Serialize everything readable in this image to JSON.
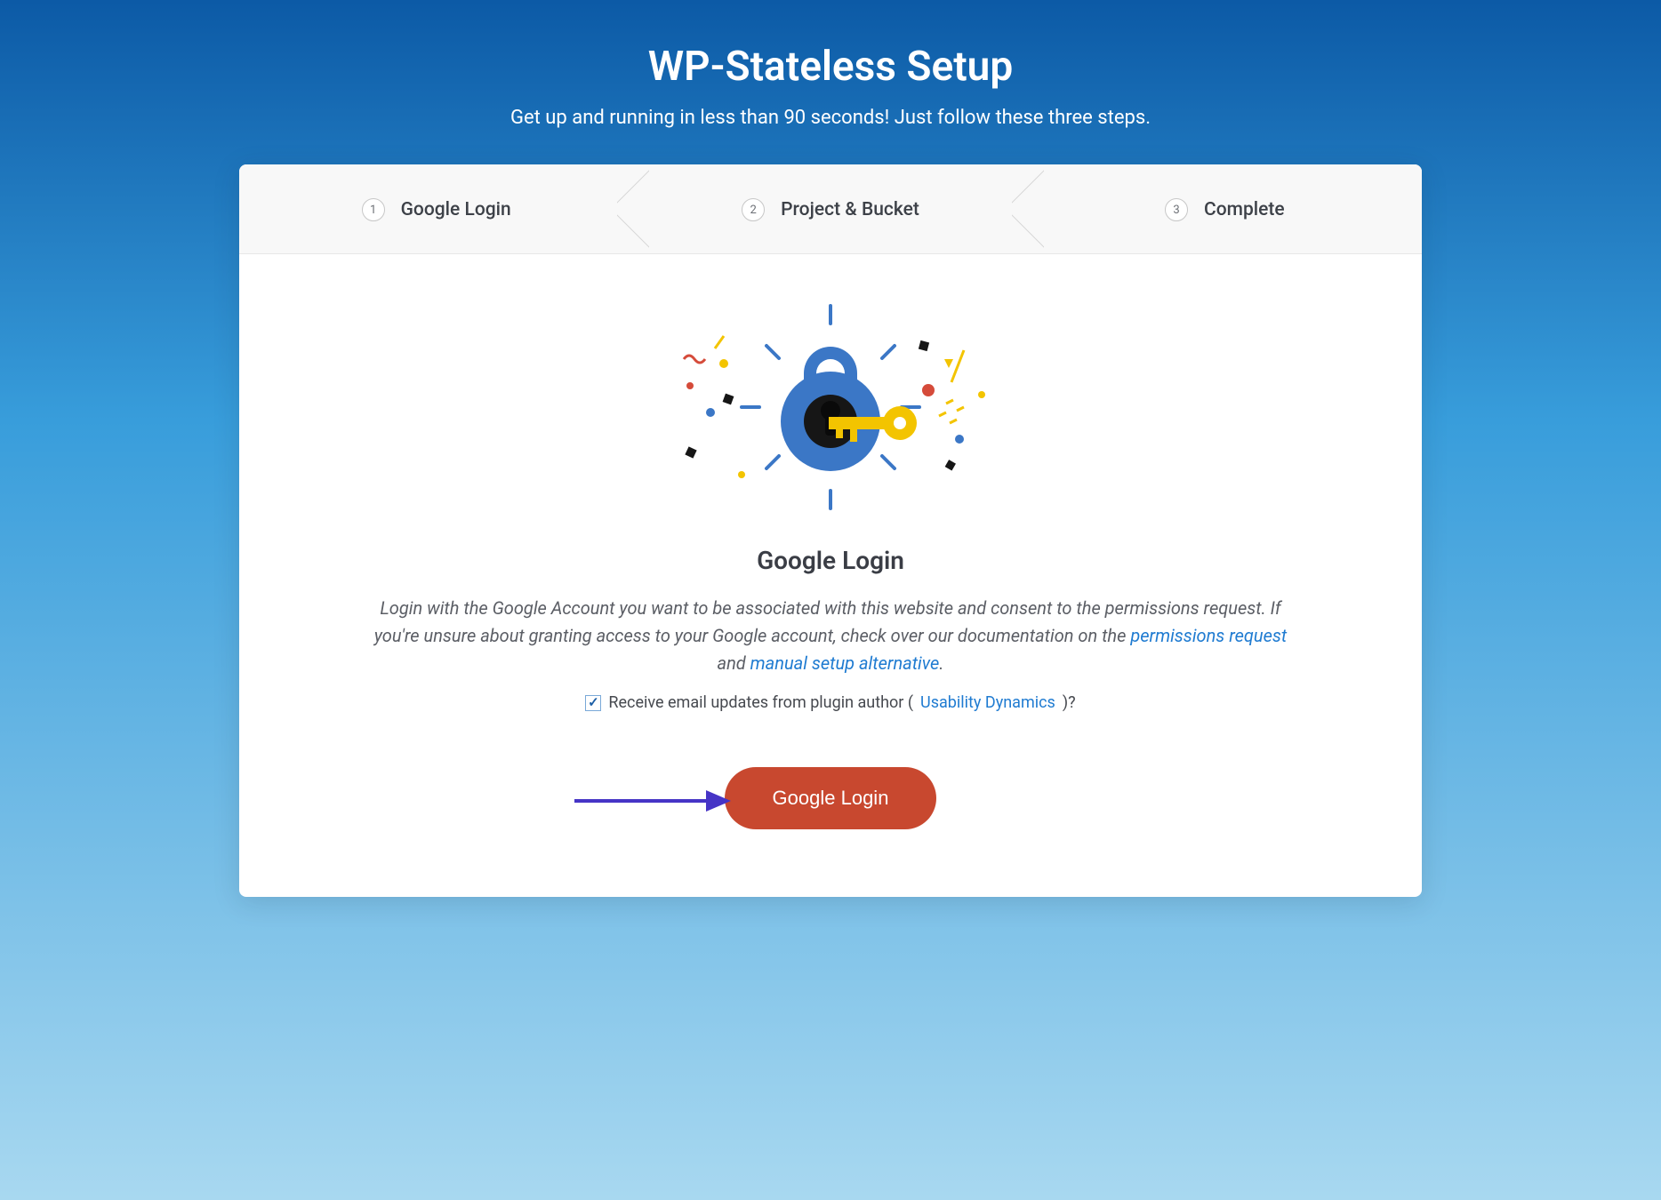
{
  "page": {
    "title": "WP-Stateless Setup",
    "subtitle": "Get up and running in less than 90 seconds! Just follow these three steps."
  },
  "steps": [
    {
      "num": "1",
      "label": "Google Login"
    },
    {
      "num": "2",
      "label": "Project & Bucket"
    },
    {
      "num": "3",
      "label": "Complete"
    }
  ],
  "section": {
    "title": "Google Login",
    "blurb_a": "Login with the Google Account you want to be associated with this website and consent to the permissions request. If you're unsure about granting access to your Google account, check over our documentation on the ",
    "link1": "permissions request",
    "blurb_b": " and ",
    "link2": "manual setup alternative",
    "blurb_c": "."
  },
  "opt": {
    "pre": "Receive email updates from plugin author (",
    "link": "Usability Dynamics",
    "post": ")?",
    "checked": true
  },
  "button": {
    "label": "Google Login"
  }
}
